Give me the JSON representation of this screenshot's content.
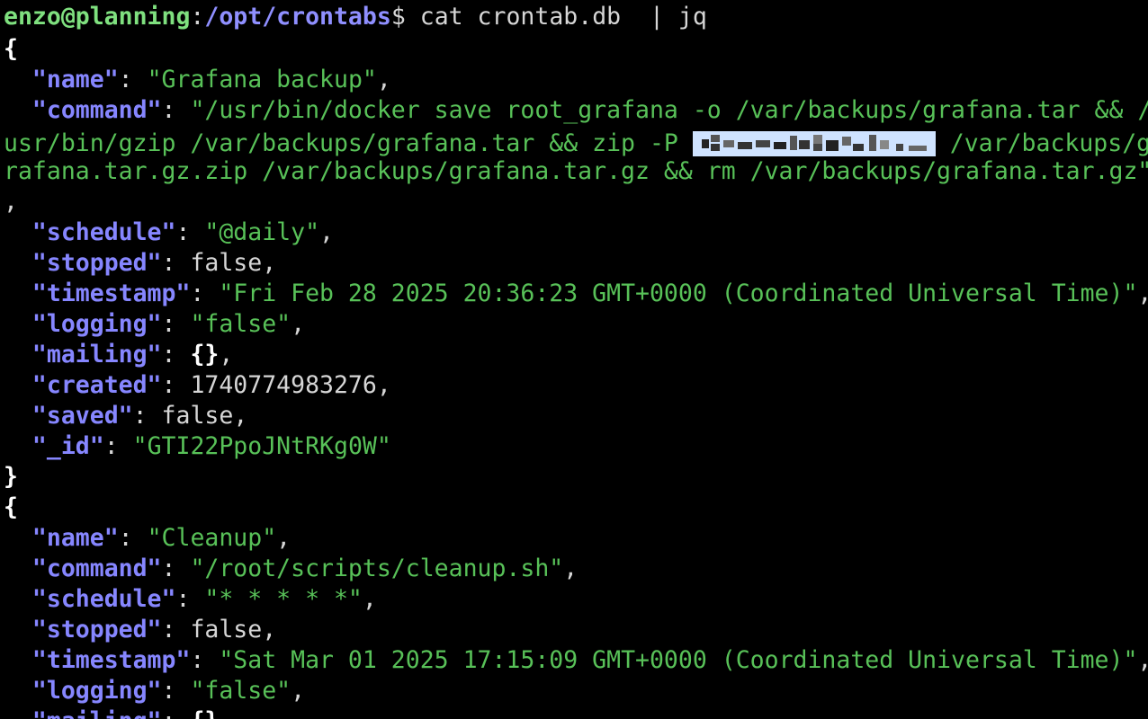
{
  "prompt": {
    "user_host": "enzo@planning",
    "separator": ":",
    "cwd": "/opt/crontabs",
    "symbol": "$",
    "command": " cat crontab.db  | jq"
  },
  "json_output": {
    "open_brace": "{",
    "close_brace": "}",
    "job1": {
      "name_key": "\"name\"",
      "name_val": "\"Grafana backup\"",
      "command_key": "\"command\"",
      "command_line1": "\"/usr/bin/docker save root_grafana -o /var/backups/grafana.tar && /",
      "command_line2_a": "usr/bin/gzip /var/backups/grafana.tar && zip -P ",
      "command_line2_b": " /var/backups/g",
      "command_line3": "rafana.tar.gz.zip /var/backups/grafana.tar.gz && rm /var/backups/grafana.tar.gz\"",
      "command_line4": ",",
      "schedule_key": "\"schedule\"",
      "schedule_val": "\"@daily\"",
      "stopped_key": "\"stopped\"",
      "stopped_val": "false",
      "timestamp_key": "\"timestamp\"",
      "timestamp_val": "\"Fri Feb 28 2025 20:36:23 GMT+0000 (Coordinated Universal Time)\"",
      "logging_key": "\"logging\"",
      "logging_val": "\"false\"",
      "mailing_key": "\"mailing\"",
      "mailing_val": "{}",
      "created_key": "\"created\"",
      "created_val": "1740774983276",
      "saved_key": "\"saved\"",
      "saved_val": "false",
      "id_key": "\"_id\"",
      "id_val": "\"GTI22PpoJNtRKg0W\""
    },
    "job2": {
      "name_key": "\"name\"",
      "name_val": "\"Cleanup\"",
      "command_key": "\"command\"",
      "command_val": "\"/root/scripts/cleanup.sh\"",
      "schedule_key": "\"schedule\"",
      "schedule_val": "\"* * * * *\"",
      "stopped_key": "\"stopped\"",
      "stopped_val": "false",
      "timestamp_key": "\"timestamp\"",
      "timestamp_val": "\"Sat Mar 01 2025 17:15:09 GMT+0000 (Coordinated Universal Time)\"",
      "logging_key": "\"logging\"",
      "logging_val": "\"false\"",
      "mailing_key": "\"mailing\"",
      "mailing_val": "{}"
    }
  },
  "punct": {
    "colon_space": ": ",
    "comma": ",",
    "indent": "  "
  },
  "colors": {
    "background": "#000000",
    "prompt_user": "#7fe07f",
    "prompt_path": "#8f8fff",
    "json_key": "#8686ff",
    "json_string": "#58c158",
    "selection": "#cfe3ff"
  }
}
